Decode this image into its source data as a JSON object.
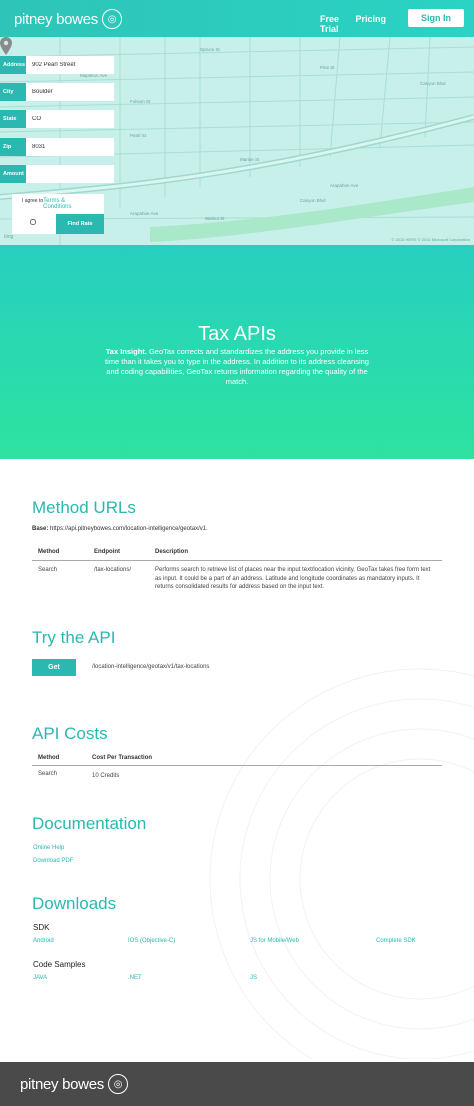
{
  "header": {
    "logo_text": "pitney bowes",
    "nav": {
      "free_trial": "Free Trial",
      "pricing": "Pricing",
      "sign_in": "Sign In"
    }
  },
  "map_form": {
    "fields": [
      {
        "label": "Address",
        "value": "902 Pearl Street"
      },
      {
        "label": "City",
        "value": "Boulder"
      },
      {
        "label": "State",
        "value": "CO"
      },
      {
        "label": "Zip",
        "value": "8031"
      },
      {
        "label": "Amount",
        "value": ""
      }
    ],
    "agree_prefix": "I agree to",
    "agree_link": "Terms & Conditions",
    "find_rate": "Find Rate",
    "bing": "bing",
    "copyright": "© 2015 HERE    © 2015 Microsoft Corporation",
    "streets": [
      "Spruce St",
      "Pine St",
      "Canyon Blvd",
      "Canyon Blvd",
      "Arapahoe Ave",
      "Arapahoe Ave",
      "Walnut St",
      "Marine St",
      "Pearl St",
      "Mapleton Ave",
      "Folsom St"
    ]
  },
  "hero": {
    "title": "Tax APIs",
    "lead": "Tax Insight.",
    "text": " GeoTax corrects and standardizes the address you provide in less time than it takes you to type in the address. In addition to its address cleansing and coding capabilities, GeoTax returns information regarding the quality of the match."
  },
  "method_urls": {
    "title": "Method URLs",
    "base_label": "Base:",
    "base_url": "https://api.pitneybowes.com/location-intelligence/geotax/v1.",
    "columns": [
      "Method",
      "Endpoint",
      "Description"
    ],
    "rows": [
      {
        "method": "Search",
        "endpoint": "/tax-locations/",
        "description": "Performs search to retrieve list of places near the input text/location vicinity. GeoTax takes free form text as input. It could be a part of an address. Latitude and longitude coordinates as mandatory inputs. It returns consolidated results for address based on the input text."
      }
    ]
  },
  "try_api": {
    "title": "Try the API",
    "button": "Get",
    "path": "/location-intelligence/geotax/v1/tax-locations"
  },
  "api_costs": {
    "title": "API Costs",
    "columns": [
      "Method",
      "Cost Per Transaction"
    ],
    "rows": [
      {
        "method": "Search",
        "cost": "10 Credits"
      }
    ]
  },
  "documentation": {
    "title": "Documentation",
    "links": [
      "Online Help",
      "Download PDF"
    ]
  },
  "downloads": {
    "title": "Downloads",
    "sdk_label": "SDK",
    "sdk_links": [
      "Android",
      "IOS (Objective-C)",
      "JS for Mobile/Web",
      "Complete SDK"
    ],
    "samples_label": "Code Samples",
    "sample_links": [
      "JAVA",
      ".NET",
      "JS"
    ]
  },
  "footer": {
    "logo_text": "pitney bowes"
  },
  "colors": {
    "accent": "#2ab8b0",
    "hero_top": "#27cfc0",
    "hero_bottom": "#2de3a0",
    "footer": "#4a4a4a"
  }
}
